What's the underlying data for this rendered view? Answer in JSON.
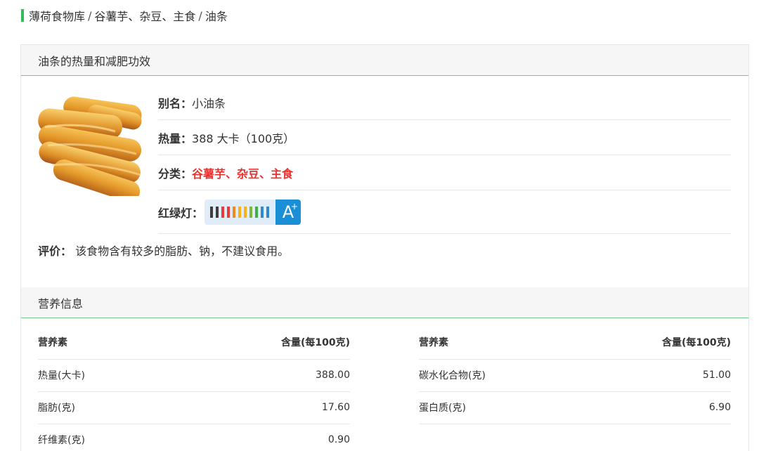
{
  "breadcrumb": {
    "items": [
      "薄荷食物库",
      "谷薯芋、杂豆、主食",
      "油条"
    ],
    "separator": "/"
  },
  "panel": {
    "title": "油条的热量和减肥功效",
    "alias_label": "别名：",
    "alias_value": "小油条",
    "calorie_label": "热量：",
    "calorie_value": "388 大卡（100克）",
    "category_label": "分类：",
    "category_value": "谷薯芋、杂豆、主食",
    "light_label": "红绿灯：",
    "light_grade": "A",
    "light_grade_sup": "+",
    "light_bar_colors": [
      "#3d3d3d",
      "#3d3d3d",
      "#e83a3a",
      "#e83a3a",
      "#f08a1c",
      "#f5b21a",
      "#f5b21a",
      "#7ab93a",
      "#3fae48",
      "#2f88c9",
      "#2f88c9"
    ],
    "evaluation_label": "评价：",
    "evaluation_value": "该食物含有较多的脂肪、钠，不建议食用。"
  },
  "nutrition": {
    "title": "营养信息",
    "headers": {
      "name": "营养素",
      "amount": "含量(每100克)"
    },
    "rows": [
      [
        {
          "name": "热量(大卡)",
          "value": "388.00"
        },
        {
          "name": "碳水化合物(克)",
          "value": "51.00"
        }
      ],
      [
        {
          "name": "脂肪(克)",
          "value": "17.60"
        },
        {
          "name": "蛋白质(克)",
          "value": "6.90"
        }
      ],
      [
        {
          "name": "纤维素(克)",
          "value": "0.90"
        },
        null
      ]
    ]
  },
  "colors": {
    "accent_green": "#33bb55",
    "category_red": "#e8332f",
    "grade_blue": "#1a8fd6"
  }
}
